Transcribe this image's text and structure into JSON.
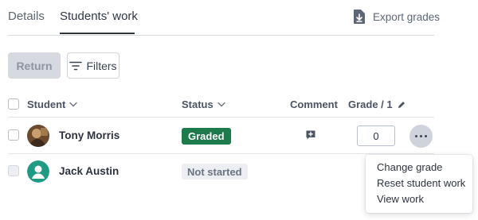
{
  "tabs": [
    {
      "label": "Details"
    },
    {
      "label": "Students' work",
      "active": true
    }
  ],
  "export": {
    "label": "Export grades",
    "icon": "download-file-icon"
  },
  "toolbar": {
    "return_label": "Return",
    "filters_label": "Filters"
  },
  "table": {
    "headers": {
      "student": "Student",
      "status": "Status",
      "comment": "Comment",
      "grade": "Grade / 1"
    },
    "rows": [
      {
        "name": "Tony Morris",
        "status": "Graded",
        "grade": "0",
        "has_comment": true
      },
      {
        "name": "Jack Austin",
        "status": "Not started"
      }
    ]
  },
  "menu": {
    "items": [
      "Change grade",
      "Reset student work",
      "View work"
    ]
  },
  "colors": {
    "graded_badge": "#1d7a4a",
    "not_started_badge": "#eceef2",
    "avatar_teal": "#1f9a83"
  }
}
